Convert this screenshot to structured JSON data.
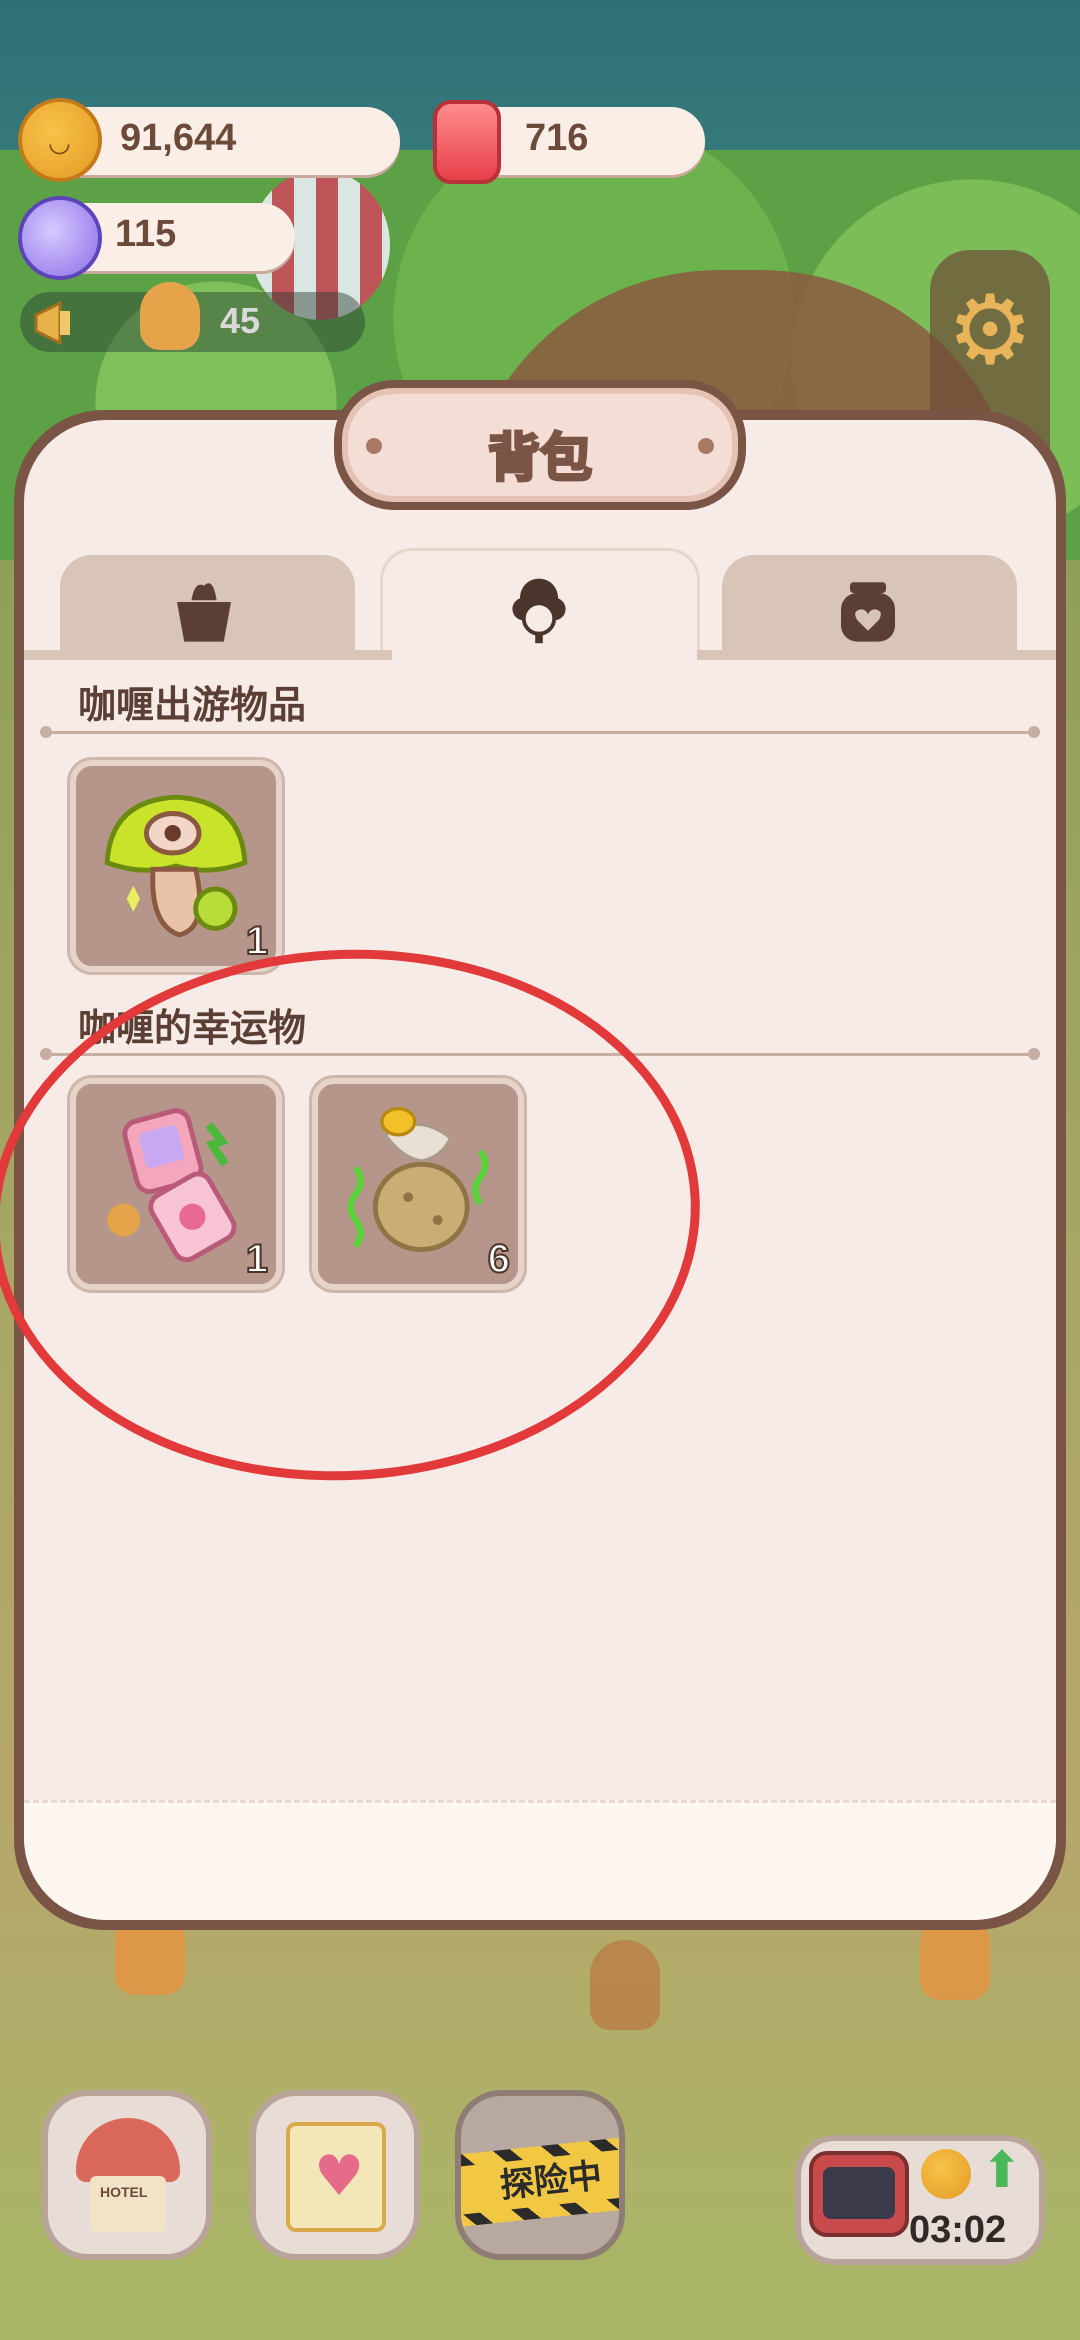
{
  "currencies": {
    "cookies": "91,644",
    "candles": "716",
    "candy": "115"
  },
  "notice": {
    "count": "45"
  },
  "panel": {
    "title": "背包",
    "tabs": [
      {
        "icon": "box-icon"
      },
      {
        "icon": "curry-chef-icon",
        "active": true
      },
      {
        "icon": "jar-heart-icon"
      }
    ],
    "sections": [
      {
        "title": "咖喱出游物品",
        "items": [
          {
            "icon": "mushroom-donut-icon",
            "count": "1"
          }
        ]
      },
      {
        "title": "咖喱的幸运物",
        "items": [
          {
            "icon": "pink-flip-phone-icon",
            "count": "1"
          },
          {
            "icon": "stinky-potato-icon",
            "count": "6"
          }
        ]
      }
    ]
  },
  "bottom_bar": {
    "hotel_sign": "HOTEL",
    "explore_label": "探险中",
    "timer": "03:02"
  },
  "colors": {
    "panel_border": "#7a5445",
    "panel_bg": "#f6ebe6",
    "highlight": "#e23a3a",
    "slot_bg": "#b6968a"
  }
}
